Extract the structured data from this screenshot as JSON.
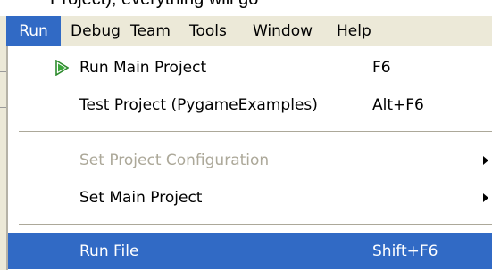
{
  "top_strip_text": "Project), everything will go",
  "menubar": {
    "items": [
      "Run",
      "Debug",
      "Team",
      "Tools",
      "Window",
      "Help"
    ],
    "active": "Run"
  },
  "menu": {
    "items": [
      {
        "label": "Run Main Project",
        "shortcut": "F6",
        "icon": "run-triangle-icon",
        "state": "normal"
      },
      {
        "label": "Test Project (PygameExamples)",
        "shortcut": "Alt+F6",
        "state": "normal"
      },
      {
        "label": "Set Project Configuration",
        "shortcut": "",
        "submenu": true,
        "state": "disabled"
      },
      {
        "label": "Set Main Project",
        "shortcut": "",
        "submenu": true,
        "state": "normal"
      },
      {
        "label": "Run File",
        "shortcut": "Shift+F6",
        "state": "highlighted"
      }
    ]
  },
  "colors": {
    "highlight": "#316ac5",
    "menubar_bg": "#ece9d8",
    "disabled_text": "#aca899",
    "run_icon": "#3aa63a"
  }
}
